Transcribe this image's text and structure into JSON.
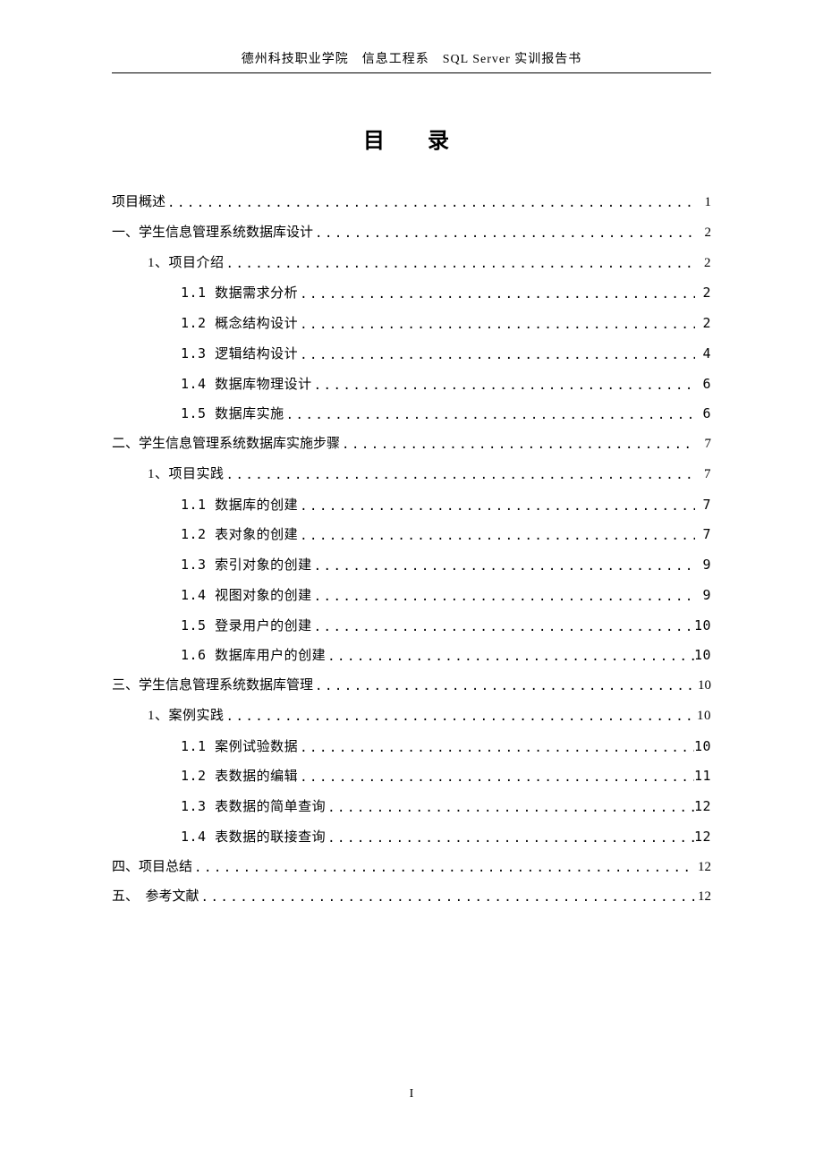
{
  "header": "德州科技职业学院 信息工程系 SQL Server 实训报告书",
  "title": "目 录",
  "page_number": "I",
  "toc": [
    {
      "label": "项目概述",
      "page": "1",
      "level": 0
    },
    {
      "label": "一、学生信息管理系统数据库设计",
      "page": "2",
      "level": 0
    },
    {
      "label": "1、项目介绍",
      "page": "2",
      "level": 1
    },
    {
      "label": "1.1 数据需求分析",
      "page": "2",
      "level": 2
    },
    {
      "label": "1.2 概念结构设计",
      "page": "2",
      "level": 2
    },
    {
      "label": "1.3 逻辑结构设计",
      "page": "4",
      "level": 2
    },
    {
      "label": "1.4 数据库物理设计",
      "page": "6",
      "level": 2
    },
    {
      "label": "1.5 数据库实施",
      "page": "6",
      "level": 2
    },
    {
      "label": "二、学生信息管理系统数据库实施步骤",
      "page": "7",
      "level": 0
    },
    {
      "label": "1、项目实践",
      "page": "7",
      "level": 1
    },
    {
      "label": "1.1 数据库的创建",
      "page": "7",
      "level": 2
    },
    {
      "label": "1.2 表对象的创建",
      "page": "7",
      "level": 2
    },
    {
      "label": "1.3 索引对象的创建",
      "page": "9",
      "level": 2
    },
    {
      "label": "1.4 视图对象的创建",
      "page": "9",
      "level": 2
    },
    {
      "label": "1.5 登录用户的创建",
      "page": "10",
      "level": 2
    },
    {
      "label": "1.6 数据库用户的创建",
      "page": "10",
      "level": 2
    },
    {
      "label": "三、学生信息管理系统数据库管理",
      "page": "10",
      "level": 0
    },
    {
      "label": "1、案例实践",
      "page": "10",
      "level": 1
    },
    {
      "label": "1.1 案例试验数据",
      "page": "10",
      "level": 2
    },
    {
      "label": "1.2 表数据的编辑",
      "page": "11",
      "level": 2
    },
    {
      "label": "1.3 表数据的简单查询",
      "page": "12",
      "level": 2
    },
    {
      "label": "1.4 表数据的联接查询",
      "page": "12",
      "level": 2
    },
    {
      "label": "四、项目总结",
      "page": "12",
      "level": 0
    },
    {
      "label": "五、 参考文献",
      "page": "12",
      "level": 0
    }
  ]
}
